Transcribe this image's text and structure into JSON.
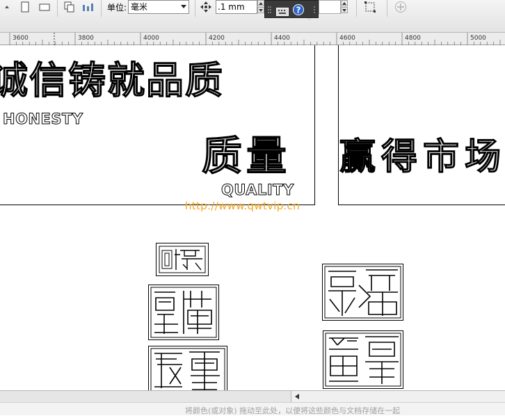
{
  "propbar": {
    "units_label": "单位:",
    "units_value": "毫米",
    "nudge_value": ".1 mm"
  },
  "ruler": {
    "ticks": [
      "3600",
      "3800",
      "4000",
      "4200",
      "4400",
      "4600",
      "4800",
      "5000"
    ]
  },
  "artwork": {
    "line1": "诚信铸就品质",
    "honesty": "HONESTY",
    "line2": "质量",
    "quality": "QUALITY",
    "line3": "赢得市场"
  },
  "watermark": "http://www.qwtvip.cn",
  "status": {
    "hint": "将颜色(或对象) 拖动至此处，以便将这些颜色与文档存储在一起"
  },
  "colors": {
    "watermark": "#f2a624",
    "help_icon": "#2c64c8"
  }
}
